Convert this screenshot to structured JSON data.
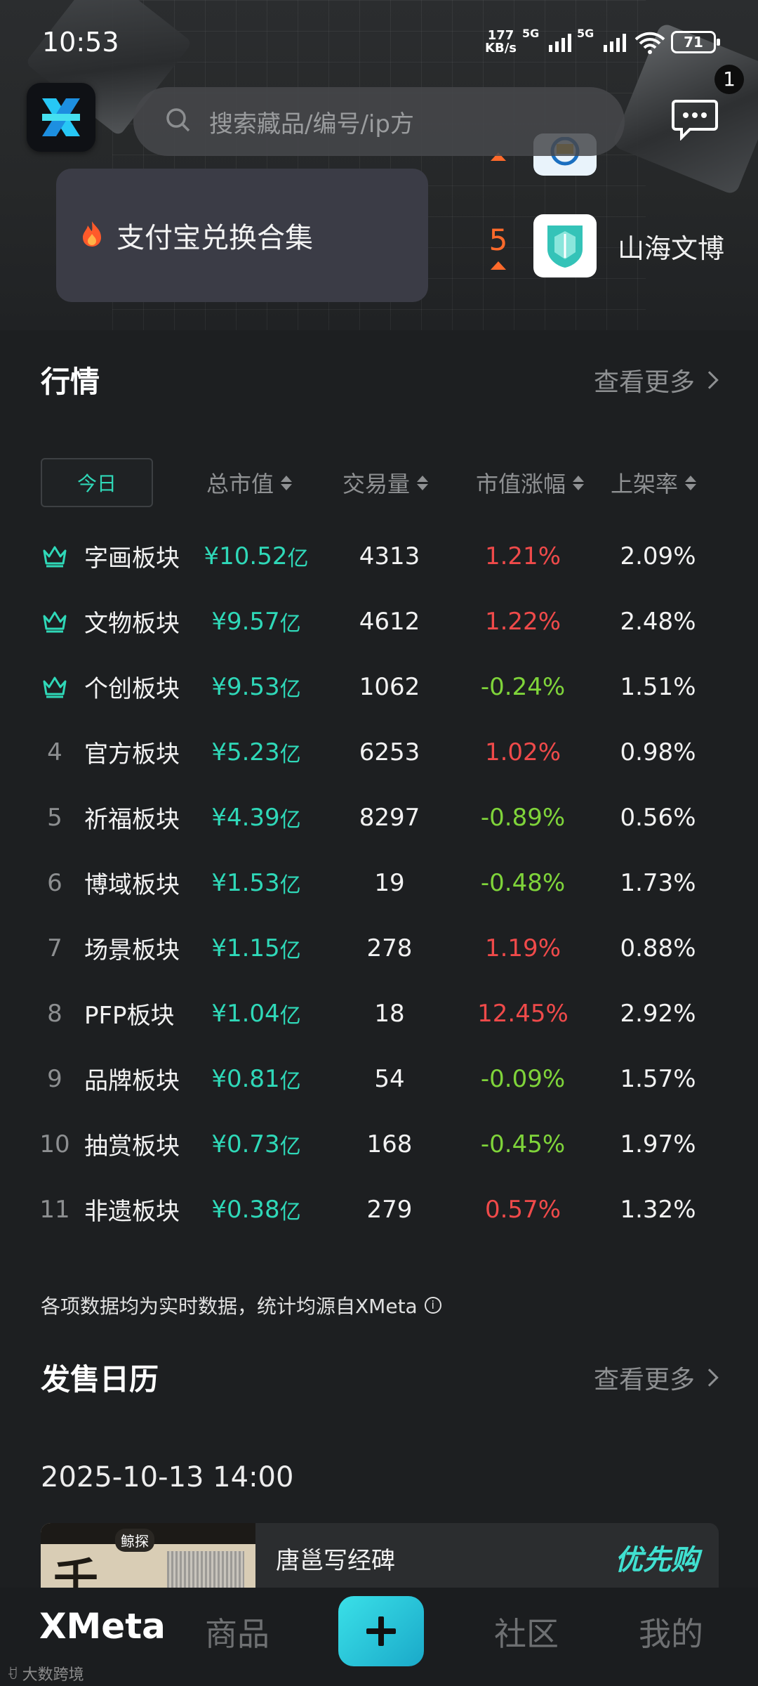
{
  "status": {
    "time": "10:53",
    "net_speed_top": "177",
    "net_speed_bottom": "KB/s",
    "sig1": "5G",
    "sig2": "5G",
    "battery": "71"
  },
  "header": {
    "search_placeholder": "搜索藏品/编号/ip方",
    "msg_badge": "1"
  },
  "hero": {
    "alipay_label": "支付宝兑换合集",
    "rank5_num": "5",
    "rank5_name": "山海文博"
  },
  "market": {
    "title": "行情",
    "more": "查看更多",
    "period": "今日",
    "columns": [
      "总市值",
      "交易量",
      "市值涨幅",
      "上架率"
    ],
    "rows": [
      {
        "rank": "",
        "icon": "crown-icon",
        "name": "字画板块",
        "cap": "¥10.52",
        "unit": "亿",
        "vol": "4313",
        "chg": "1.21%",
        "dir": "up",
        "rate": "2.09%"
      },
      {
        "rank": "",
        "icon": "crown-icon",
        "name": "文物板块",
        "cap": "¥9.57",
        "unit": "亿",
        "vol": "4612",
        "chg": "1.22%",
        "dir": "up",
        "rate": "2.48%"
      },
      {
        "rank": "",
        "icon": "crown-icon",
        "name": "个创板块",
        "cap": "¥9.53",
        "unit": "亿",
        "vol": "1062",
        "chg": "-0.24%",
        "dir": "down",
        "rate": "1.51%"
      },
      {
        "rank": "4",
        "name": "官方板块",
        "cap": "¥5.23",
        "unit": "亿",
        "vol": "6253",
        "chg": "1.02%",
        "dir": "up",
        "rate": "0.98%"
      },
      {
        "rank": "5",
        "name": "祈福板块",
        "cap": "¥4.39",
        "unit": "亿",
        "vol": "8297",
        "chg": "-0.89%",
        "dir": "down",
        "rate": "0.56%"
      },
      {
        "rank": "6",
        "name": "博域板块",
        "cap": "¥1.53",
        "unit": "亿",
        "vol": "19",
        "chg": "-0.48%",
        "dir": "down",
        "rate": "1.73%"
      },
      {
        "rank": "7",
        "name": "场景板块",
        "cap": "¥1.15",
        "unit": "亿",
        "vol": "278",
        "chg": "1.19%",
        "dir": "up",
        "rate": "0.88%"
      },
      {
        "rank": "8",
        "name": "PFP板块",
        "cap": "¥1.04",
        "unit": "亿",
        "vol": "18",
        "chg": "12.45%",
        "dir": "up",
        "rate": "2.92%"
      },
      {
        "rank": "9",
        "name": "品牌板块",
        "cap": "¥0.81",
        "unit": "亿",
        "vol": "54",
        "chg": "-0.09%",
        "dir": "down",
        "rate": "1.57%"
      },
      {
        "rank": "10",
        "name": "抽赏板块",
        "cap": "¥0.73",
        "unit": "亿",
        "vol": "168",
        "chg": "-0.45%",
        "dir": "down",
        "rate": "1.97%"
      },
      {
        "rank": "11",
        "name": "非遗板块",
        "cap": "¥0.38",
        "unit": "亿",
        "vol": "279",
        "chg": "0.57%",
        "dir": "up",
        "rate": "1.32%"
      }
    ],
    "note": "各项数据均为实时数据，统计均源自XMeta"
  },
  "calendar": {
    "title": "发售日历",
    "more": "查看更多",
    "date": "2025-10-13 14:00",
    "item_title": "唐邕写经碑",
    "item_tag": "优先购",
    "thumb_badge": "鲸探",
    "thumb_char": "千"
  },
  "nav": {
    "brand": "XMeta",
    "goods": "商品",
    "community": "社区",
    "mine": "我的"
  },
  "watermark": "大数跨境",
  "colors": {
    "accent": "#2fd8b8",
    "up": "#ef4a4a",
    "down": "#7fd43a",
    "rank_orange": "#ff6a2b"
  }
}
